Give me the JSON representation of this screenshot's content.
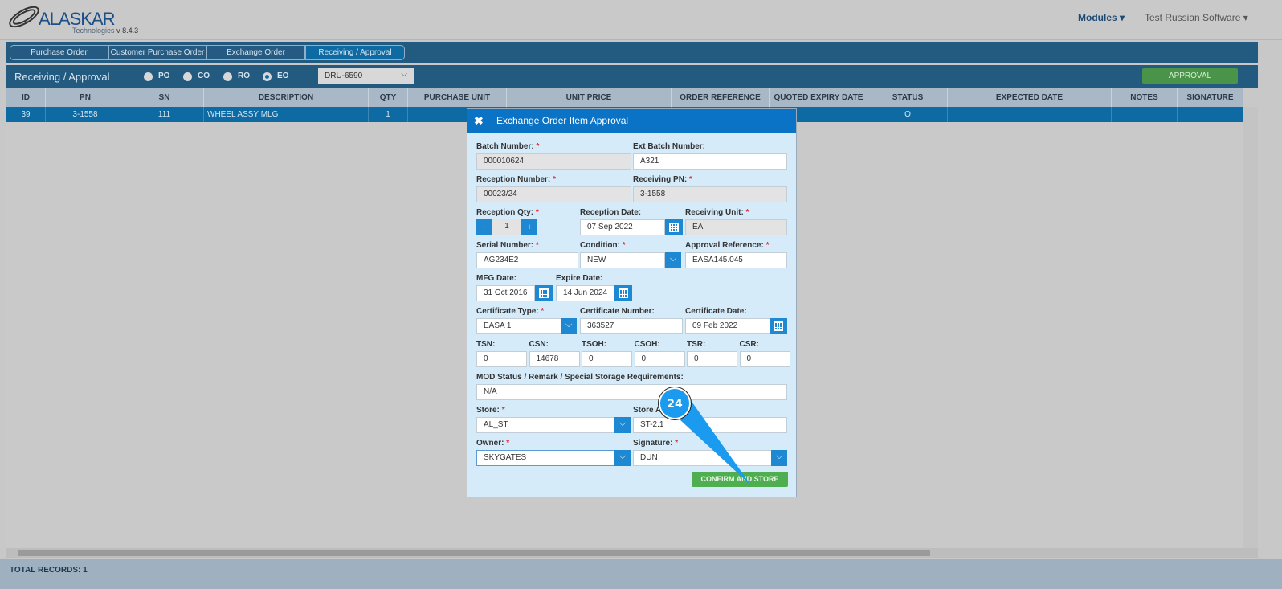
{
  "app": {
    "logo": "ALASKAR",
    "logo_sub": "Technologies",
    "version": "v 8.4.3",
    "modules": "Modules ▾",
    "user": "Test Russian Software ▾"
  },
  "tabs": [
    "Purchase Order",
    "Customer Purchase Order",
    "Exchange Order",
    "Receiving / Approval"
  ],
  "subbar": {
    "title": "Receiving / Approval",
    "radios": [
      "PO",
      "CO",
      "RO",
      "EO"
    ],
    "selected_radio": "EO",
    "order_select": "DRU-6590",
    "approval_button": "APPROVAL"
  },
  "table": {
    "columns": [
      "ID",
      "PN",
      "SN",
      "DESCRIPTION",
      "QTY",
      "PURCHASE UNIT",
      "UNIT PRICE",
      "ORDER REFERENCE",
      "QUOTED EXPIRY DATE",
      "STATUS",
      "EXPECTED DATE",
      "NOTES",
      "SIGNATURE"
    ],
    "rows": [
      [
        "39",
        "3-1558",
        "111",
        "WHEEL ASSY MLG",
        "1",
        "",
        "",
        "",
        "",
        "O",
        "",
        "",
        ""
      ]
    ]
  },
  "footer": {
    "total": "TOTAL RECORDS: 1"
  },
  "modal": {
    "title": "Exchange Order Item Approval",
    "batch_number": {
      "label": "Batch Number:",
      "value": "000010624"
    },
    "ext_batch_number": {
      "label": "Ext Batch Number:",
      "value": "A321"
    },
    "reception_number": {
      "label": "Reception Number:",
      "value": "00023/24"
    },
    "receiving_pn": {
      "label": "Receiving PN:",
      "value": "3-1558"
    },
    "reception_qty": {
      "label": "Reception Qty:",
      "value": "1"
    },
    "reception_date": {
      "label": "Reception Date:",
      "value": "07 Sep 2022"
    },
    "receiving_unit": {
      "label": "Receiving Unit:",
      "value": "EA"
    },
    "serial_number": {
      "label": "Serial Number:",
      "value": "AG234E2"
    },
    "condition": {
      "label": "Condition:",
      "value": "NEW"
    },
    "approval_reference": {
      "label": "Approval Reference:",
      "value": "EASA145.045"
    },
    "mfg_date": {
      "label": "MFG Date:",
      "value": "31 Oct 2016"
    },
    "expire_date": {
      "label": "Expire Date:",
      "value": "14 Jun 2024"
    },
    "certificate_type": {
      "label": "Certificate Type:",
      "value": "EASA 1"
    },
    "certificate_number": {
      "label": "Certificate Number:",
      "value": "363527"
    },
    "certificate_date": {
      "label": "Certificate Date:",
      "value": "09 Feb 2022"
    },
    "counters": [
      {
        "label": "TSN:",
        "value": "0"
      },
      {
        "label": "CSN:",
        "value": "14678"
      },
      {
        "label": "TSOH:",
        "value": "0"
      },
      {
        "label": "CSOH:",
        "value": "0"
      },
      {
        "label": "TSR:",
        "value": "0"
      },
      {
        "label": "CSR:",
        "value": "0"
      }
    ],
    "mod_status": {
      "label": "MOD Status / Remark / Special Storage Requirements:",
      "value": "N/A"
    },
    "store": {
      "label": "Store:",
      "value": "AL_ST"
    },
    "store_address": {
      "label": "Store A",
      "value": "ST-2.1"
    },
    "owner": {
      "label": "Owner:",
      "value": "SKYGATES"
    },
    "signature": {
      "label": "Signature:",
      "value": "DUN"
    },
    "confirm_button": "CONFIRM AND STORE",
    "required_mark": "*"
  },
  "callout": {
    "number": "24",
    "color": "#1a9bf0"
  }
}
